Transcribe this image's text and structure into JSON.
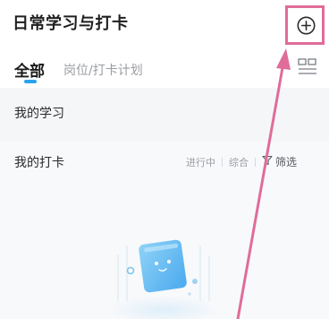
{
  "header": {
    "title": "日常学习与打卡"
  },
  "tabs": {
    "all": "全部",
    "plan": "岗位/打卡计划"
  },
  "sections": {
    "my_study": "我的学习",
    "my_checkin": "我的打卡"
  },
  "filters": {
    "in_progress": "进行中",
    "overall": "综合",
    "filter_label": "筛选"
  },
  "icons": {
    "add": "plus-circle-icon",
    "layout": "layout-grid-icon",
    "filter": "funnel-icon",
    "empty": "empty-state-illustration"
  },
  "colors": {
    "accent": "#2aa3ee",
    "annotation": "#e06c9a"
  }
}
